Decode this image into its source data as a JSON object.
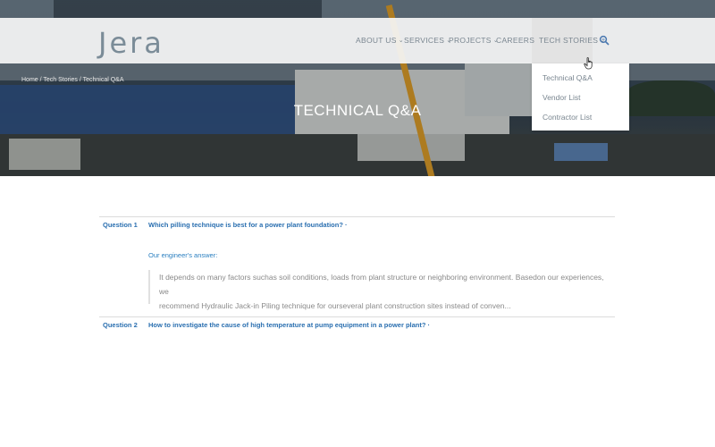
{
  "brand": {
    "logo_text": "Jera"
  },
  "nav": {
    "items": [
      {
        "label": "ABOUT US",
        "has_dropdown": true
      },
      {
        "label": "SERVICES",
        "has_dropdown": true
      },
      {
        "label": "PROJECTS",
        "has_dropdown": true
      },
      {
        "label": "CAREERS",
        "has_dropdown": false
      },
      {
        "label": "TECH STORIES",
        "has_dropdown": true,
        "active": true
      }
    ],
    "search_icon": "magnifier-icon"
  },
  "dropdown": {
    "items": [
      "Technical Q&A",
      "Vendor List",
      "Contractor List"
    ]
  },
  "hero": {
    "breadcrumb": "Home / Tech Stories / Technical Q&A",
    "title": "TECHNICAL Q&A"
  },
  "qa": [
    {
      "label": "Question 1",
      "question": "Which pilling technique is best for a power plant foundation? ·",
      "answer_label": "Our engineer's answer:",
      "answer_line1": "It depends on many factors suchas soil conditions, loads from plant structure or neighboring environment. Basedon our experiences, we",
      "answer_line2": "recommend Hydraulic Jack-in Piling technique for ourseveral plant construction sites instead of conven..."
    },
    {
      "label": "Question 2",
      "question": "How to investigate the cause of high temperature at pump equipment in a power plant? ·"
    }
  ],
  "colors": {
    "accent": "#2a6fb0",
    "nav_text": "#7a8690",
    "header_bg": "#f5f5f5"
  }
}
